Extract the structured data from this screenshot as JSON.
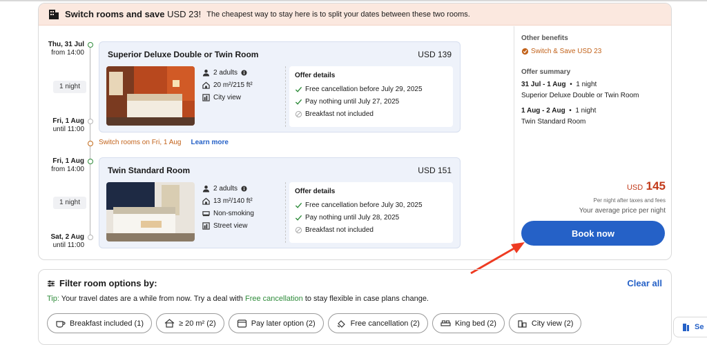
{
  "banner": {
    "title": "Switch rooms and save",
    "save_amount": "USD 23!",
    "description": "The cheapest way to stay here is to split your dates between these two rooms."
  },
  "timeline": {
    "stay1": {
      "checkin_date": "Thu, 31 Jul",
      "checkin_time": "from 14:00",
      "nights": "1 night",
      "checkout_date": "Fri, 1 Aug",
      "checkout_time": "until 11:00"
    },
    "switch_text": "Switch rooms on Fri, 1 Aug",
    "learn_more": "Learn more",
    "stay2": {
      "checkin_date": "Fri, 1 Aug",
      "checkin_time": "from 14:00",
      "nights": "1 night",
      "checkout_date": "Sat, 2 Aug",
      "checkout_time": "until 11:00"
    }
  },
  "rooms": [
    {
      "name": "Superior Deluxe Double or Twin Room",
      "price": "USD 139",
      "features": [
        "2 adults",
        "20 m²/215 ft²",
        "City view"
      ],
      "offer_title": "Offer details",
      "offers": [
        "Free cancellation before July 29, 2025",
        "Pay nothing until July 27, 2025",
        "Breakfast not included"
      ]
    },
    {
      "name": "Twin Standard Room",
      "price": "USD 151",
      "features": [
        "2 adults",
        "13 m²/140 ft²",
        "Non-smoking",
        "Street view"
      ],
      "offer_title": "Offer details",
      "offers": [
        "Free cancellation before July 30, 2025",
        "Pay nothing until July 28, 2025",
        "Breakfast not included"
      ]
    }
  ],
  "summary": {
    "benefits_label": "Other benefits",
    "benefit": "Switch & Save USD 23",
    "summary_label": "Offer summary",
    "stay1_dates": "31 Jul - 1 Aug",
    "stay1_nights": "1 night",
    "stay1_room": "Superior Deluxe Double or Twin Room",
    "stay2_dates": "1 Aug - 2 Aug",
    "stay2_nights": "1 night",
    "stay2_room": "Twin Standard Room",
    "currency": "USD",
    "amount": "145",
    "per_night": "Per night after taxes and fees",
    "avg": "Your average price per night",
    "book_label": "Book now"
  },
  "filters": {
    "title": "Filter room options by:",
    "clear_all": "Clear all",
    "tip_label": "Tip:",
    "tip_text_1": "Your travel dates are a while from now. Try a deal with",
    "tip_green": "Free cancellation",
    "tip_text_2": "to stay flexible in case plans change.",
    "chips": [
      "Breakfast included (1)",
      "≥ 20 m² (2)",
      "Pay later option (2)",
      "Free cancellation (2)",
      "King bed (2)",
      "City view (2)"
    ]
  },
  "side_pill": {
    "label": "Se"
  },
  "colors": {
    "accent": "#2561c7",
    "banner_bg": "#fbe8df",
    "price_red": "#c23a1a",
    "green": "#2e8b3a",
    "orange": "#c2621a"
  }
}
